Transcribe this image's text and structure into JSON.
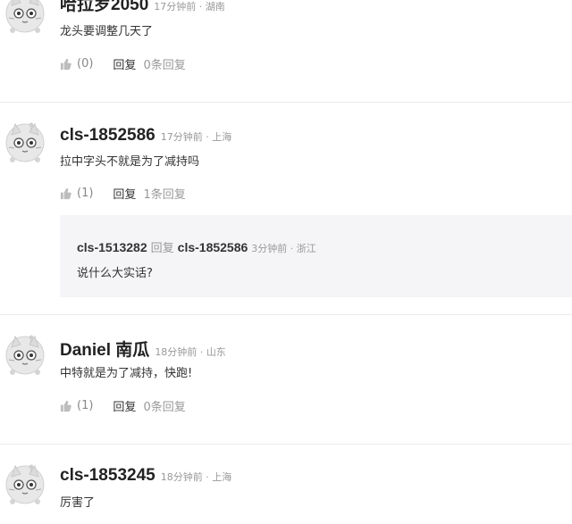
{
  "comments": [
    {
      "author": "哈拉罗2050",
      "time": "17分钟前",
      "location": "湖南",
      "content": "龙头要调整几天了",
      "likes": "(0)",
      "reply_label": "回复",
      "reply_count": "0条回复"
    },
    {
      "author": "cls-1852586",
      "time": "17分钟前",
      "location": "上海",
      "content": "拉中字头不就是为了减持吗",
      "likes": "(1)",
      "reply_label": "回复",
      "reply_count": "1条回复",
      "reply": {
        "from": "cls-1513282",
        "verb": "回复",
        "to": "cls-1852586",
        "time": "3分钟前",
        "location": "浙江",
        "content": "说什么大实话?"
      }
    },
    {
      "author": "Daniel 南瓜",
      "time": "18分钟前",
      "location": "山东",
      "content": "中特就是为了减持，快跑!",
      "likes": "(1)",
      "reply_label": "回复",
      "reply_count": "0条回复"
    },
    {
      "author": "cls-1853245",
      "time": "18分钟前",
      "location": "上海",
      "content": "厉害了"
    }
  ],
  "separator": " · ",
  "icons": {
    "avatar": "cat-avatar-icon",
    "like": "thumbs-up-icon"
  },
  "colors": {
    "author": "#222222",
    "meta": "#999999",
    "reply_bg": "#f5f5f7",
    "divider": "#ececec"
  }
}
